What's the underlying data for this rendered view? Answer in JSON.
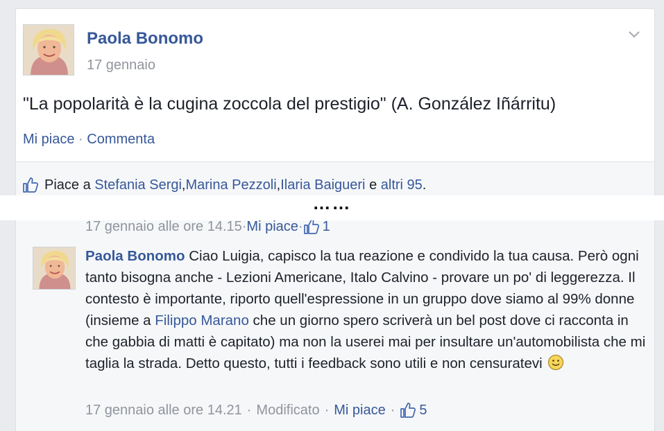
{
  "post": {
    "author": "Paola Bonomo",
    "date": "17 gennaio",
    "text": "\"La popolarità è la cugina zoccola del prestigio\" (A. González Iñárritu)",
    "actions": {
      "like": "Mi piace",
      "separator": " · ",
      "comment": "Commenta"
    },
    "likes": {
      "prefix": "Piace a ",
      "people": [
        "Stefania Sergi",
        "Marina Pezzoli",
        "Ilaria Baigueri"
      ],
      "comma": ", ",
      "and": " e ",
      "others": "altri 95",
      "suffix": "."
    }
  },
  "separator": "……",
  "previous_comment_meta": {
    "timestamp": "17 gennaio alle ore 14.15",
    "sep": " · ",
    "like": "Mi piace",
    "likes_count": "1"
  },
  "comment": {
    "author": "Paola Bonomo",
    "text_before_tag": " Ciao Luigia, capisco la tua reazione e condivido la tua causa. Però ogni tanto bisogna anche - Lezioni Americane, Italo Calvino - provare un po' di leggerezza. Il contesto è importante, riporto quell'espressione in un gruppo dove siamo al 99% donne (insieme a ",
    "tagged_person": "Filippo Marano",
    "text_after_tag": " che un giorno spero scriverà un bel post dove ci racconta in che gabbia di matti è capitato) ma non la userei mai per insultare un'automobilista che mi taglia la strada. Detto questo, tutti i feedback sono utili e non censuratevi ",
    "emoji": "smiley-icon",
    "timestamp": "17 gennaio alle ore 14.21",
    "edited": "Modificato",
    "like": "Mi piace",
    "sep": "·",
    "likes_count": "5"
  },
  "colors": {
    "link": "#365899",
    "meta_gray": "#90949c",
    "text": "#1d2129",
    "background": "#e9ebee",
    "panel": "#f6f7f9"
  }
}
